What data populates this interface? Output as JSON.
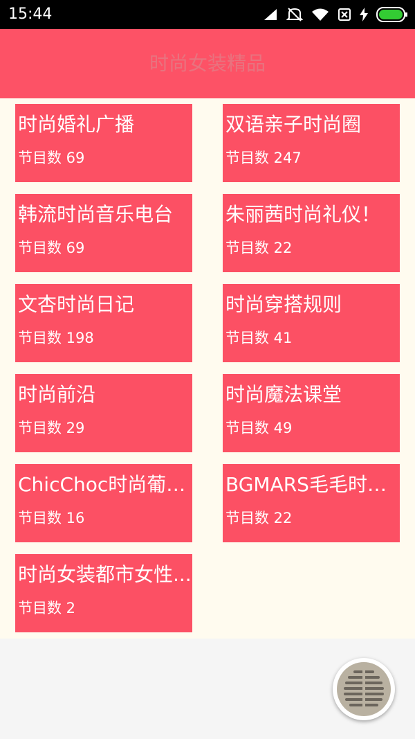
{
  "status_bar": {
    "time": "15:44",
    "icons": [
      "signal-icon",
      "mute-icon",
      "wifi-icon",
      "sim-off-icon",
      "charging-icon",
      "battery-icon"
    ]
  },
  "app_bar": {
    "title": "时尚女装精品"
  },
  "items": [
    {
      "title": "时尚婚礼广播",
      "count": "节目数 69"
    },
    {
      "title": "双语亲子时尚圈",
      "count": "节目数 247"
    },
    {
      "title": "韩流时尚音乐电台",
      "count": "节目数 69"
    },
    {
      "title": "朱丽茜时尚礼仪！",
      "count": "节目数 22"
    },
    {
      "title": "文杏时尚日记",
      "count": "节目数 198"
    },
    {
      "title": "时尚穿搭规则",
      "count": "节目数 41"
    },
    {
      "title": "时尚前沿",
      "count": "节目数 29"
    },
    {
      "title": "时尚魔法课堂",
      "count": "节目数 49"
    },
    {
      "title": "ChicChoc时尚葡萄...",
      "count": "节目数 16"
    },
    {
      "title": "BGMARS毛毛时尚...",
      "count": "节目数 22"
    },
    {
      "title": "时尚女装都市女性...",
      "count": "节目数 2"
    }
  ],
  "colors": {
    "accent": "#fd5266",
    "card": "#fc5064",
    "content_bg": "#fffbef"
  },
  "fab": {
    "icon": "radio-grille-icon"
  }
}
